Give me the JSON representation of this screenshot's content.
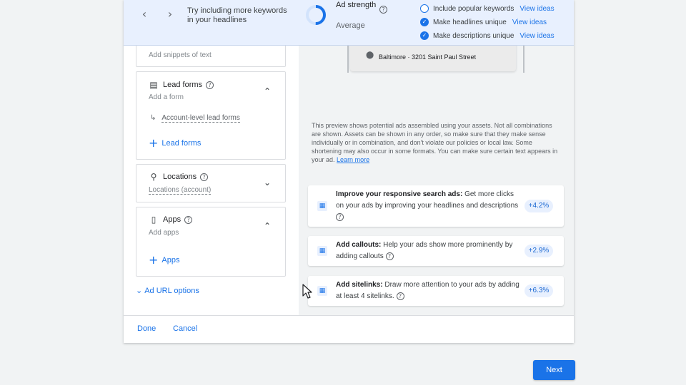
{
  "strength_bar": {
    "tip": "Try including more keywords in your headlines",
    "label": "Ad strength",
    "value": "Average",
    "progress": 0.5,
    "checklist": [
      {
        "label": "Include popular keywords",
        "done": false,
        "link": "View ideas"
      },
      {
        "label": "Make headlines unique",
        "done": true,
        "link": "View ideas"
      },
      {
        "label": "Make descriptions unique",
        "done": true,
        "link": "View ideas"
      }
    ]
  },
  "left": {
    "snippets_sub": "Add snippets of text",
    "lead_forms": {
      "title": "Lead forms",
      "sub": "Add a form",
      "account_link": "Account-level lead forms",
      "add": "Lead forms"
    },
    "locations": {
      "title": "Locations",
      "sub": "Locations (account)"
    },
    "apps": {
      "title": "Apps",
      "sub": "Add apps",
      "add": "Apps"
    },
    "ad_url_options": "Ad URL options"
  },
  "preview": {
    "location": "Baltimore · 3201 Saint Paul Street",
    "disclaimer": "This preview shows potential ads assembled using your assets. Not all combinations are shown. Assets can be shown in any order, so make sure that they make sense individually or in combination, and don't violate our policies or local law. Some shortening may also occur in some formats. You can make sure certain text appears in your ad.",
    "learn_more": "Learn more"
  },
  "recommendations": [
    {
      "title": "Improve your responsive search ads:",
      "body": "Get more clicks on your ads by improving your headlines and descriptions",
      "uplift": "+4.2%"
    },
    {
      "title": "Add callouts:",
      "body": "Help your ads show more prominently by adding callouts",
      "uplift": "+2.9%"
    },
    {
      "title": "Add sitelinks:",
      "body": "Draw more attention to your ads by adding at least 4 sitelinks.",
      "uplift": "+6.3%"
    }
  ],
  "footer": {
    "done": "Done",
    "cancel": "Cancel"
  },
  "next": "Next",
  "colors": {
    "accent": "#1a73e8",
    "banner": "#e8f0fe"
  }
}
